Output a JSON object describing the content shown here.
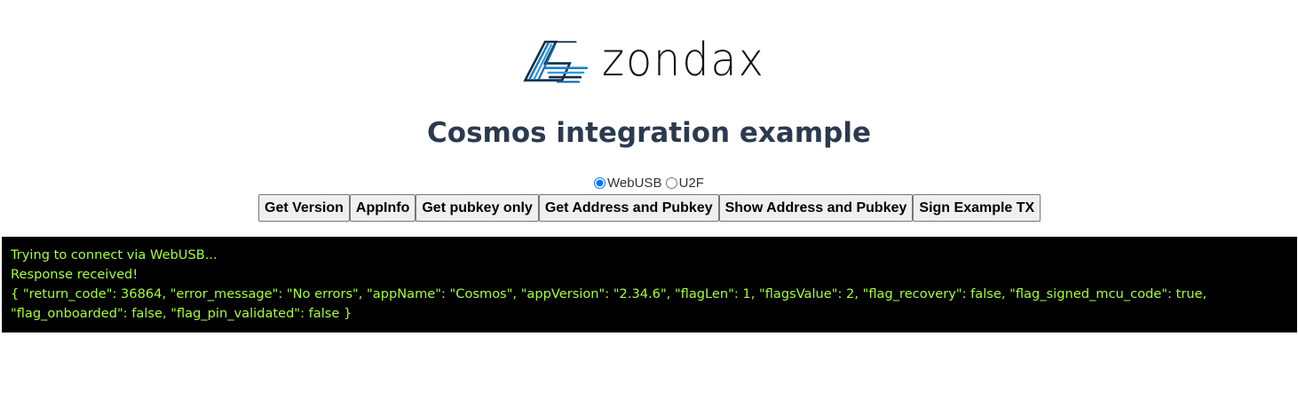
{
  "logo": {
    "text": "zondax"
  },
  "page": {
    "title": "Cosmos integration example"
  },
  "transport": {
    "options": [
      {
        "label": "WebUSB",
        "selected": true
      },
      {
        "label": "U2F",
        "selected": false
      }
    ]
  },
  "buttons": [
    {
      "label": "Get Version"
    },
    {
      "label": "AppInfo"
    },
    {
      "label": "Get pubkey only"
    },
    {
      "label": "Get Address and Pubkey"
    },
    {
      "label": "Show Address and Pubkey"
    },
    {
      "label": "Sign Example TX"
    }
  ],
  "console": {
    "lines": [
      "Trying to connect via WebUSB...",
      "Response received!",
      "{ \"return_code\": 36864, \"error_message\": \"No errors\", \"appName\": \"Cosmos\", \"appVersion\": \"2.34.6\", \"flagLen\": 1, \"flagsValue\": 2, \"flag_recovery\": false, \"flag_signed_mcu_code\": true, \"flag_onboarded\": false, \"flag_pin_validated\": false }"
    ]
  },
  "colors": {
    "console_bg": "#000000",
    "console_text": "#a6ff3b",
    "title": "#2b3a4f",
    "logo_blue": "#1f7fc4"
  }
}
